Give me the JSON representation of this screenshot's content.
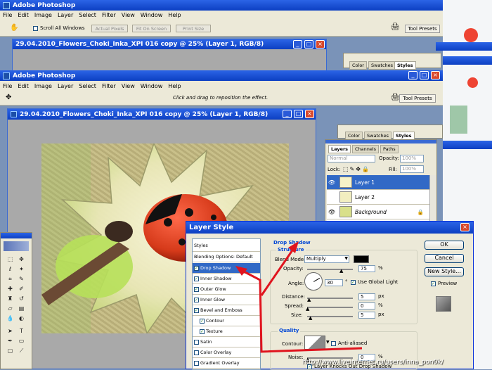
{
  "app1": {
    "title": "Adobe Photoshop",
    "menu": [
      "File",
      "Edit",
      "Image",
      "Layer",
      "Select",
      "Filter",
      "View",
      "Window",
      "Help"
    ],
    "scroll_all": "Scroll All Windows",
    "btns": [
      "Actual Pixels",
      "Fit On Screen",
      "Print Size"
    ],
    "tool_presets": "Tool Presets"
  },
  "doc1": {
    "title": "29.04.2010_Flowers_Choki_Inka_XPI 016 copy @ 25% (Layer 1, RGB/8)"
  },
  "app2": {
    "title": "Adobe Photoshop",
    "menu": [
      "File",
      "Edit",
      "Image",
      "Layer",
      "Select",
      "Filter",
      "View",
      "Window",
      "Help"
    ],
    "hint": "Click and drag to reposition the effect.",
    "tool_presets": "Tool Presets"
  },
  "doc2": {
    "title": "29.04.2010_Flowers_Choki_Inka_XPI 016 copy @ 25% (Layer 1, RGB/8)"
  },
  "bgpanels": {
    "tabs1": [
      "Color",
      "Swatches",
      "Styles"
    ],
    "tabs2": [
      "Color",
      "Swatches",
      "Styles"
    ]
  },
  "layers": {
    "tabs": [
      "Layers",
      "Channels",
      "Paths"
    ],
    "blend": "Normal",
    "opacity_label": "Opacity:",
    "opacity": "100%",
    "lock_label": "Lock:",
    "fill_label": "Fill:",
    "fill": "100%",
    "rows": [
      {
        "name": "Layer 1"
      },
      {
        "name": "Layer 2"
      },
      {
        "name": "Background"
      }
    ]
  },
  "dialog": {
    "title": "Layer Style",
    "styles_header": "Styles",
    "blending": "Blending Options: Default",
    "items": [
      "Drop Shadow",
      "Inner Shadow",
      "Outer Glow",
      "Inner Glow",
      "Bevel and Emboss",
      "Contour",
      "Texture",
      "Satin",
      "Color Overlay",
      "Gradient Overlay"
    ],
    "section": "Drop Shadow",
    "structure": "Structure",
    "blend_mode_label": "Blend Mode:",
    "blend_mode": "Multiply",
    "opacity_label": "Opacity:",
    "opacity": "75",
    "pct": "%",
    "angle_label": "Angle:",
    "angle": "30",
    "deg": "°",
    "global_light": "Use Global Light",
    "distance_label": "Distance:",
    "distance": "5",
    "spread_label": "Spread:",
    "spread": "0",
    "size_label": "Size:",
    "size": "5",
    "px": "px",
    "quality": "Quality",
    "contour_label": "Contour:",
    "antialiased": "Anti-aliased",
    "noise_label": "Noise:",
    "noise": "0",
    "knockout": "Layer Knocks Out Drop Shadow",
    "ok": "OK",
    "cancel": "Cancel",
    "new_style": "New Style...",
    "preview": "Preview"
  },
  "watermark": "http://www.liveinternet.ru/users/inna_pon0k/",
  "colors": {
    "title_blue": "#0c3fc2",
    "selection": "#3169c6",
    "arrow": "#e0141e",
    "shadow_swatch": "#000000"
  }
}
